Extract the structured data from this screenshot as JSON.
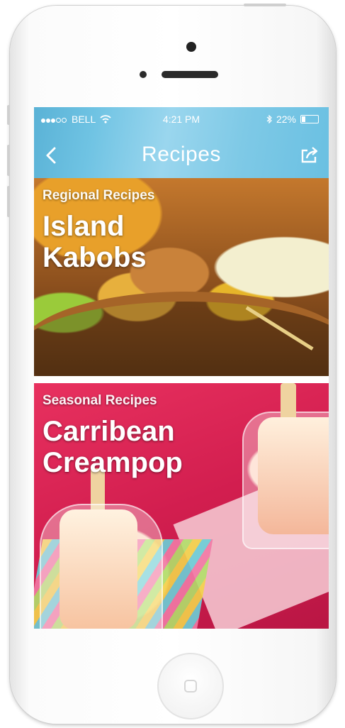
{
  "status_bar": {
    "carrier": "BELL",
    "time": "4:21 PM",
    "battery": "22%",
    "battery_level": 0.22,
    "signal_bars_filled": 3,
    "signal_bars_total": 5
  },
  "nav": {
    "title": "Recipes",
    "back_icon": "chevron-left-icon",
    "share_icon": "share-icon"
  },
  "recipes": [
    {
      "category": "Regional Recipes",
      "title_line1": "Island",
      "title_line2": "Kabobs"
    },
    {
      "category": "Seasonal Recipes",
      "title_line1": "Carribean",
      "title_line2": "Creampop"
    }
  ],
  "colors": {
    "header_blue": "#6fc3e3",
    "card2_pink": "#d21e4f"
  }
}
